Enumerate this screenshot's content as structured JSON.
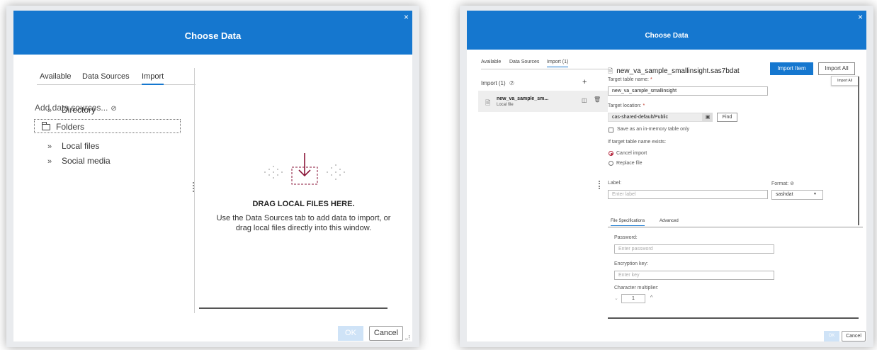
{
  "left_dialog": {
    "title": "Choose Data",
    "close_glyph": "×",
    "tabs": [
      "Available",
      "Data Sources",
      "Import"
    ],
    "active_tab": "Import",
    "add_data_sources_label": "Add data sources...",
    "help_glyph": "⊘",
    "sources": [
      {
        "chevron": "»",
        "label": "Directory"
      },
      {
        "icon": "folder-icon",
        "label": "Folders"
      },
      {
        "chevron": "»",
        "label": "Local files"
      },
      {
        "chevron": "»",
        "label": "Social media"
      }
    ],
    "drop_title": "DRAG LOCAL FILES HERE.",
    "drop_text": "Use the Data Sources tab to add data to import, or drag local files directly into this window.",
    "ok_label": "OK",
    "cancel_label": "Cancel"
  },
  "right_dialog": {
    "title": "Choose Data",
    "close_glyph": "×",
    "tabs": [
      "Available",
      "Data Sources",
      "Import (1)"
    ],
    "active_tab": "Import (1)",
    "import_count_label": "Import (1)",
    "import_help_glyph": "⑦",
    "add_glyph": "+",
    "file_item": {
      "name": "new_va_sample_sm...",
      "type": "Local file"
    },
    "main_title": "new_va_sample_smallinsight.sas7bdat",
    "import_item_label": "Import Item",
    "import_all_label": "Import All",
    "tooltip": "Import All",
    "target_table_label": "Target table name:",
    "target_table_value": "new_va_sample_smallinsight",
    "target_location_label": "Target location:",
    "target_location_value": "cas-shared-default/Public",
    "find_label": "Find",
    "save_in_memory_label": "Save as an in-memory table only",
    "exists_label": "If target table name exists:",
    "cancel_import_label": "Cancel import",
    "replace_file_label": "Replace file",
    "label_label": "Label:",
    "label_placeholder": "Enter label",
    "format_label": "Format:",
    "format_help_glyph": "⊘",
    "format_value": "sashdat",
    "subtabs": [
      "File Specifications",
      "Advanced"
    ],
    "password_label": "Password:",
    "password_placeholder": "Enter password",
    "encryption_label": "Encryption key:",
    "encryption_placeholder": "Enter key",
    "char_mult_label": "Character multiplier:",
    "char_mult_value": "1",
    "ok_label": "OK",
    "cancel_label": "Cancel"
  }
}
